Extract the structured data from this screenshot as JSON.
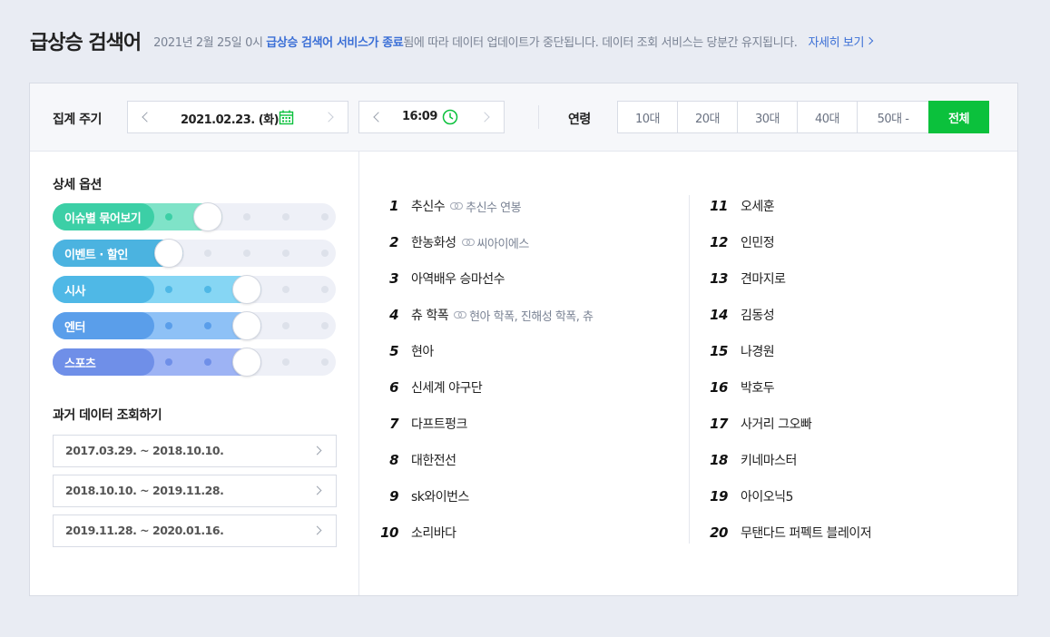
{
  "header": {
    "title": "급상승 검색어",
    "notice_pre": "2021년 2월 25일 0시 ",
    "notice_highlight": "급상승 검색어 서비스가 종료",
    "notice_post": "됨에 따라 데이터 업데이트가 중단됩니다. 데이터 조회 서비스는 당분간 유지됩니다.",
    "more_label": "자세히 보기"
  },
  "toolbar": {
    "period_label": "집계 주기",
    "date_value": "2021.02.23. (화)",
    "time_value": "16:09",
    "age_label": "연령",
    "age_options": [
      "10대",
      "20대",
      "30대",
      "40대",
      "50대 -",
      "전체"
    ],
    "age_selected": "전체",
    "accent": "#0bc13c"
  },
  "options": {
    "title": "상세 옵션",
    "sliders": [
      {
        "label": "이슈별 묶어보기",
        "level": 1,
        "max": 4,
        "color": "#3ccfa6",
        "light": "#7fe3c8"
      },
      {
        "label": "이벤트 · 할인",
        "level": 0,
        "max": 4,
        "color": "#4bb3e0",
        "light": "#8fd2ef"
      },
      {
        "label": "시사",
        "level": 2,
        "max": 4,
        "color": "#4fb8e6",
        "light": "#86d6f4"
      },
      {
        "label": "엔터",
        "level": 2,
        "max": 4,
        "color": "#5a9eea",
        "light": "#8ec1f6"
      },
      {
        "label": "스포츠",
        "level": 2,
        "max": 4,
        "color": "#6f8fe8",
        "light": "#9db3f4"
      }
    ]
  },
  "history": {
    "title": "과거 데이터 조회하기",
    "ranges": [
      "2017.03.29. ~ 2018.10.10.",
      "2018.10.10. ~ 2019.11.28.",
      "2019.11.28. ~ 2020.01.16."
    ]
  },
  "ranking": [
    {
      "rank": "1",
      "keyword": "추신수",
      "related": "추신수 연봉"
    },
    {
      "rank": "2",
      "keyword": "한농화성",
      "related": "씨아이에스"
    },
    {
      "rank": "3",
      "keyword": "아역배우 승마선수",
      "related": ""
    },
    {
      "rank": "4",
      "keyword": "츄 학폭",
      "related": "현아 학폭, 진해성 학폭, 츄"
    },
    {
      "rank": "5",
      "keyword": "현아",
      "related": ""
    },
    {
      "rank": "6",
      "keyword": "신세계 야구단",
      "related": ""
    },
    {
      "rank": "7",
      "keyword": "다프트펑크",
      "related": ""
    },
    {
      "rank": "8",
      "keyword": "대한전선",
      "related": ""
    },
    {
      "rank": "9",
      "keyword": "sk와이번스",
      "related": ""
    },
    {
      "rank": "10",
      "keyword": "소리바다",
      "related": ""
    },
    {
      "rank": "11",
      "keyword": "오세훈",
      "related": ""
    },
    {
      "rank": "12",
      "keyword": "인민정",
      "related": ""
    },
    {
      "rank": "13",
      "keyword": "견마지로",
      "related": ""
    },
    {
      "rank": "14",
      "keyword": "김동성",
      "related": ""
    },
    {
      "rank": "15",
      "keyword": "나경원",
      "related": ""
    },
    {
      "rank": "16",
      "keyword": "박호두",
      "related": ""
    },
    {
      "rank": "17",
      "keyword": "사거리 그오빠",
      "related": ""
    },
    {
      "rank": "18",
      "keyword": "키네마스터",
      "related": ""
    },
    {
      "rank": "19",
      "keyword": "아이오닉5",
      "related": ""
    },
    {
      "rank": "20",
      "keyword": "무탠다드 퍼펙트 블레이저",
      "related": ""
    }
  ]
}
